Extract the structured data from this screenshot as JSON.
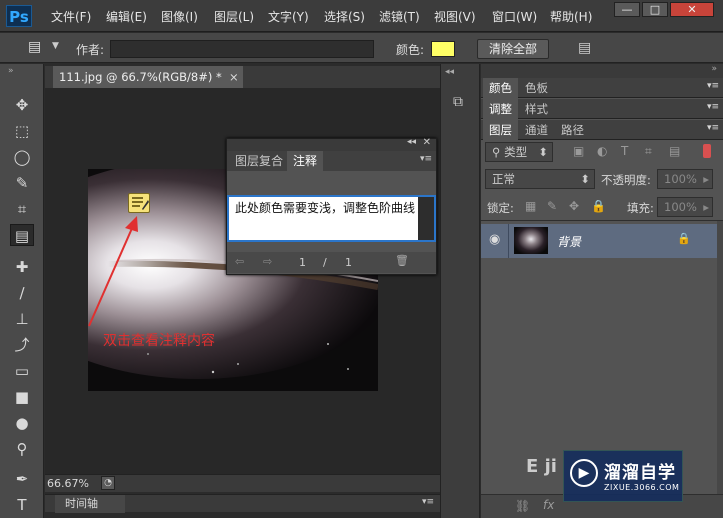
{
  "app": {
    "logo": "Ps"
  },
  "menu": [
    "文件(F)",
    "编辑(E)",
    "图像(I)",
    "图层(L)",
    "文字(Y)",
    "选择(S)",
    "滤镜(T)",
    "视图(V)",
    "窗口(W)",
    "帮助(H)"
  ],
  "window_controls": {
    "minimize": "—",
    "maximize": "□",
    "close": "✕"
  },
  "options_bar": {
    "author_label": "作者:",
    "author_value": "",
    "color_label": "颜色:",
    "note_color": "#ffff66",
    "clear_all": "清除全部"
  },
  "document": {
    "tab_title": "111.jpg @ 66.7%(RGB/8#) *",
    "tab_close": "×",
    "zoom": "66.67%"
  },
  "annotation": {
    "text": "双击查看注释内容",
    "color": "#e03030"
  },
  "notes_panel": {
    "tabs": [
      "图层复合",
      "注释"
    ],
    "active_tab": 1,
    "note_text": "此处颜色需要变浅，调整色阶曲线",
    "page_current": "1",
    "page_sep": "/",
    "page_total": "1"
  },
  "timeline": {
    "label": "时间轴"
  },
  "panels": {
    "row1_tabs": [
      "颜色",
      "色板"
    ],
    "row2_tabs": [
      "调整",
      "样式"
    ],
    "layers_tabs": [
      "图层",
      "通道",
      "路径"
    ],
    "filter_kind": "类型",
    "blend_mode": "正常",
    "opacity_label": "不透明度:",
    "opacity_value": "100%",
    "lock_label": "锁定:",
    "fill_label": "填充:",
    "fill_value": "100%",
    "layer_name": "背景"
  },
  "watermark": {
    "brand": "溜溜自学",
    "url": "ZIXUE.3066.COM",
    "partial_chars": "E ji"
  }
}
